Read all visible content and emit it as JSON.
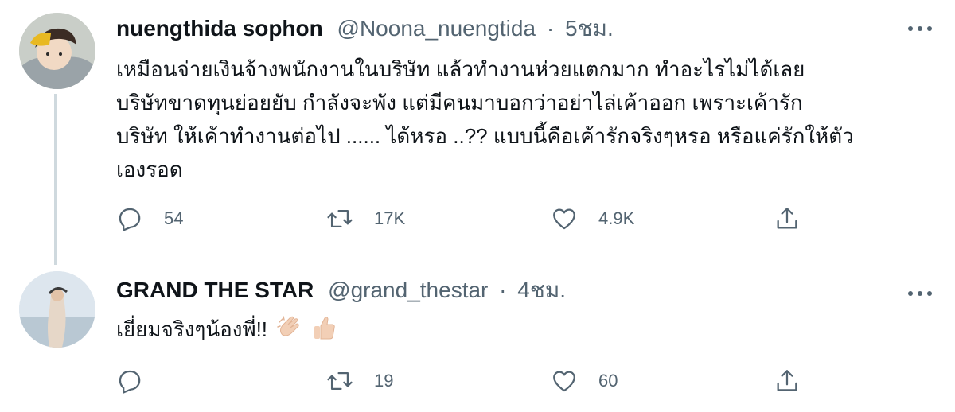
{
  "tweets": [
    {
      "name": "nuengthida sophon",
      "handle": "@Noona_nuengtida",
      "separator": "·",
      "time": "5ชม.",
      "text_lines": [
        "เหมือนจ่ายเงินจ้างพนักงานในบริษัท แล้วทำงานห่วยแตกมาก ทำอะไรไม่ได้เลย",
        "บริษัทขาดทุนย่อยยับ กำลังจะพัง แต่มีคนมาบอกว่าอย่าไล่เค้าออก เพราะเค้ารัก",
        "บริษัท ให้เค้าทำงานต่อไป ...... ได้หรอ ..?? แบบนี้คือเค้ารักจริงๆหรอ หรือแค่รักให้ตัว",
        "เองรอด"
      ],
      "reply_count": "54",
      "retweet_count": "17K",
      "like_count": "4.9K",
      "icons": [
        "reply-icon",
        "retweet-icon",
        "like-icon",
        "share-icon",
        "more-icon"
      ]
    },
    {
      "name": "GRAND THE STAR",
      "handle": "@grand_thestar",
      "separator": "·",
      "time": "4ชม.",
      "text": "เยี่ยมจริงๆน้องพี่!!",
      "emojis": [
        "clapping-hands-emoji",
        "thumbs-up-emoji"
      ],
      "reply_count": "",
      "retweet_count": "19",
      "like_count": "60",
      "icons": [
        "reply-icon",
        "retweet-icon",
        "like-icon",
        "share-icon",
        "more-icon"
      ]
    }
  ],
  "colors": {
    "text": "#0f1419",
    "secondary": "#536471",
    "thread_line": "#cfd9de"
  }
}
